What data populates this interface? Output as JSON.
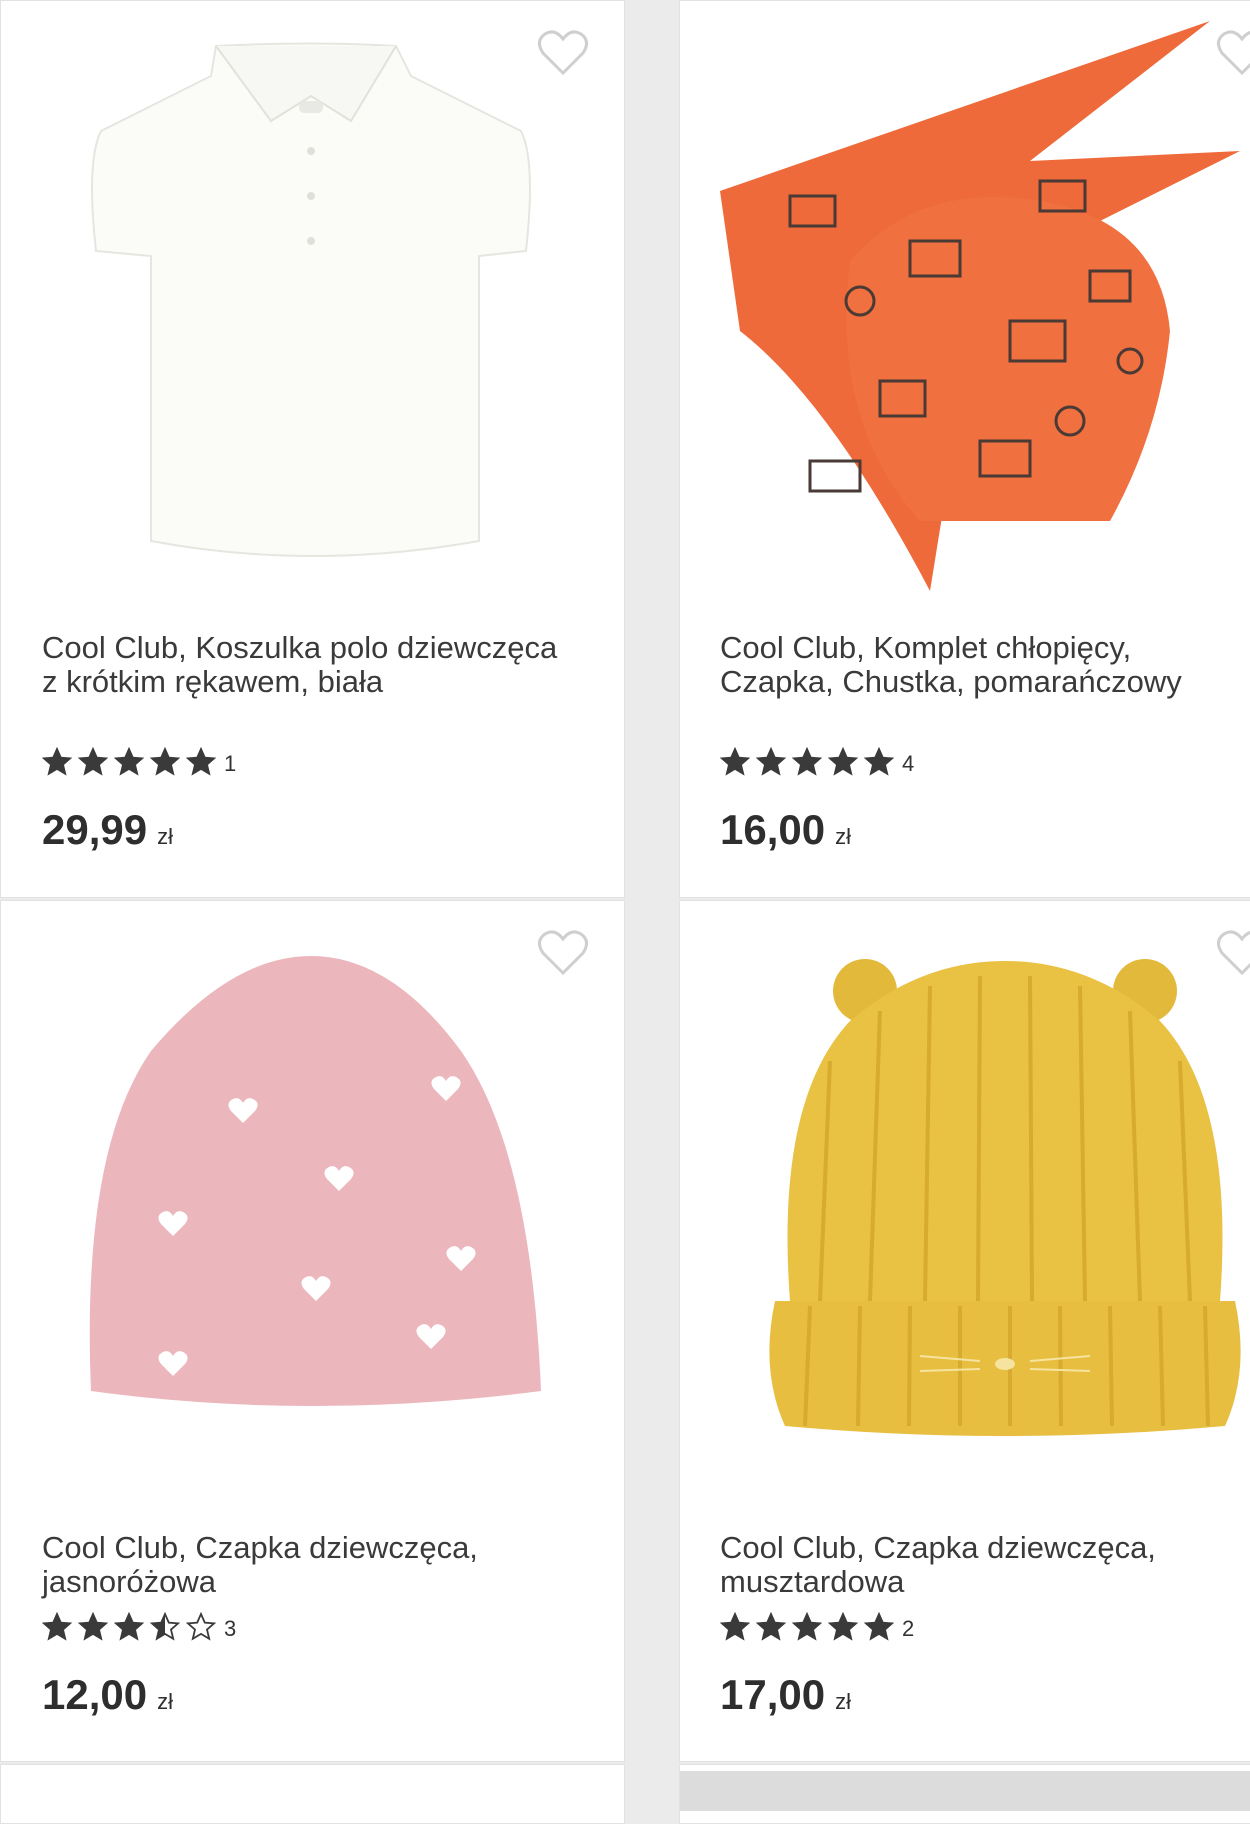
{
  "products": [
    {
      "title": "Cool Club, Koszulka polo dziewczęca z krótkim rękawem, biała",
      "stars": 5,
      "reviews": "1",
      "price": "29,99",
      "currency": "zł"
    },
    {
      "title": "Cool Club, Komplet chłopięcy, Czapka, Chustka, pomarańczowy",
      "stars": 5,
      "reviews": "4",
      "price": "16,00",
      "currency": "zł"
    },
    {
      "title": "Cool Club, Czapka dziewczęca, jasnoróżowa",
      "stars": 3.5,
      "reviews": "3",
      "price": "12,00",
      "currency": "zł"
    },
    {
      "title": "Cool Club, Czapka dziewczęca, musztardowa",
      "stars": 5,
      "reviews": "2",
      "price": "17,00",
      "currency": "zł"
    }
  ],
  "colors": {
    "star": "#3a3a3a",
    "page_bg": "#ebebeb",
    "card_bg": "#ffffff"
  }
}
